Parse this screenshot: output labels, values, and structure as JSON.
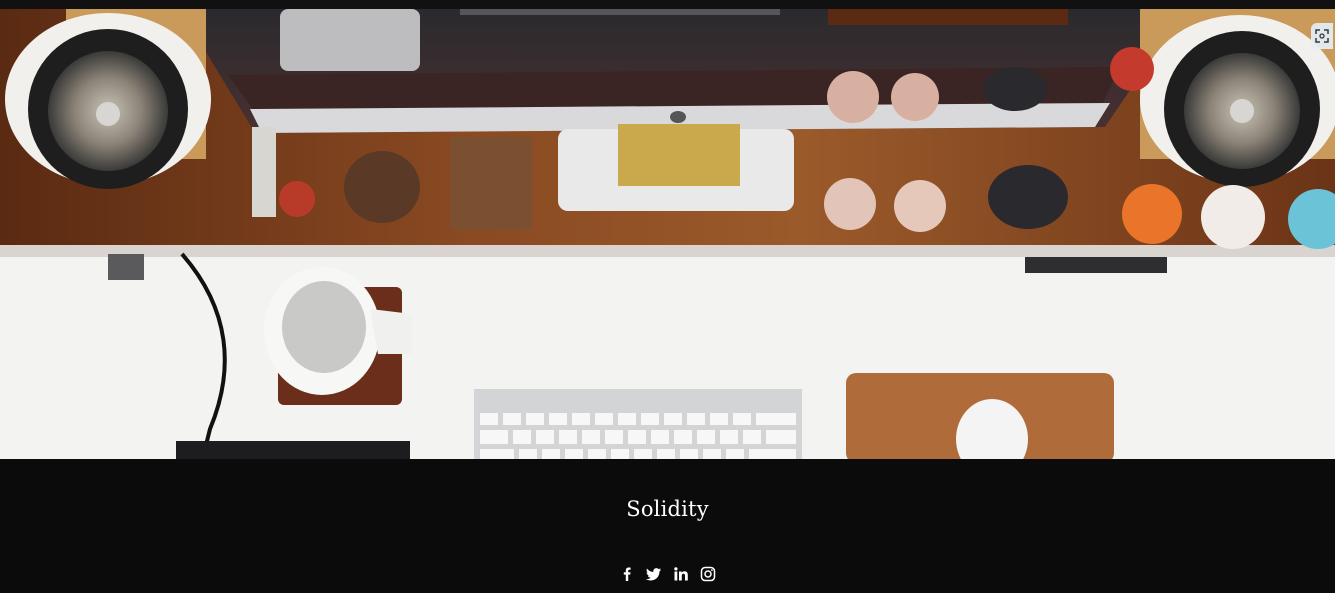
{
  "footer": {
    "brand": "Solidity"
  },
  "hero": {
    "expand_icon": "expand-icon"
  },
  "social": [
    {
      "name": "facebook-icon"
    },
    {
      "name": "twitter-icon"
    },
    {
      "name": "linkedin-icon"
    },
    {
      "name": "instagram-icon"
    }
  ],
  "colors": {
    "footer_bg": "#0b0b0b",
    "desk_wood": "#7a3e1d",
    "desk_surface": "#f4f4f4",
    "text": "#ffffff"
  }
}
